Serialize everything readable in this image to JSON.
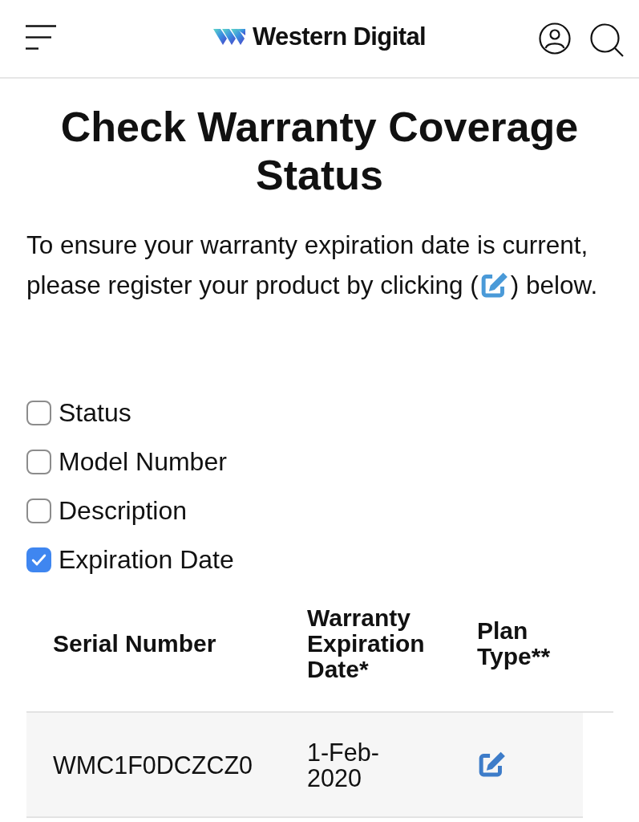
{
  "header": {
    "brand": "Western Digital"
  },
  "page": {
    "title": "Check Warranty Coverage Status",
    "instruction_before": "To ensure your warranty expiration date is current, please register your product by clicking (",
    "instruction_after": ") below."
  },
  "column_filters": [
    {
      "label": "Status",
      "checked": false
    },
    {
      "label": "Model Number",
      "checked": false
    },
    {
      "label": "Description",
      "checked": false
    },
    {
      "label": "Expiration Date",
      "checked": true
    }
  ],
  "table": {
    "columns": [
      "Serial Number",
      "Warranty Expiration Date*",
      "Plan Type**"
    ],
    "rows": [
      {
        "serial": "WMC1F0DCZCZ0",
        "expiration": "1-Feb-2020"
      }
    ]
  }
}
